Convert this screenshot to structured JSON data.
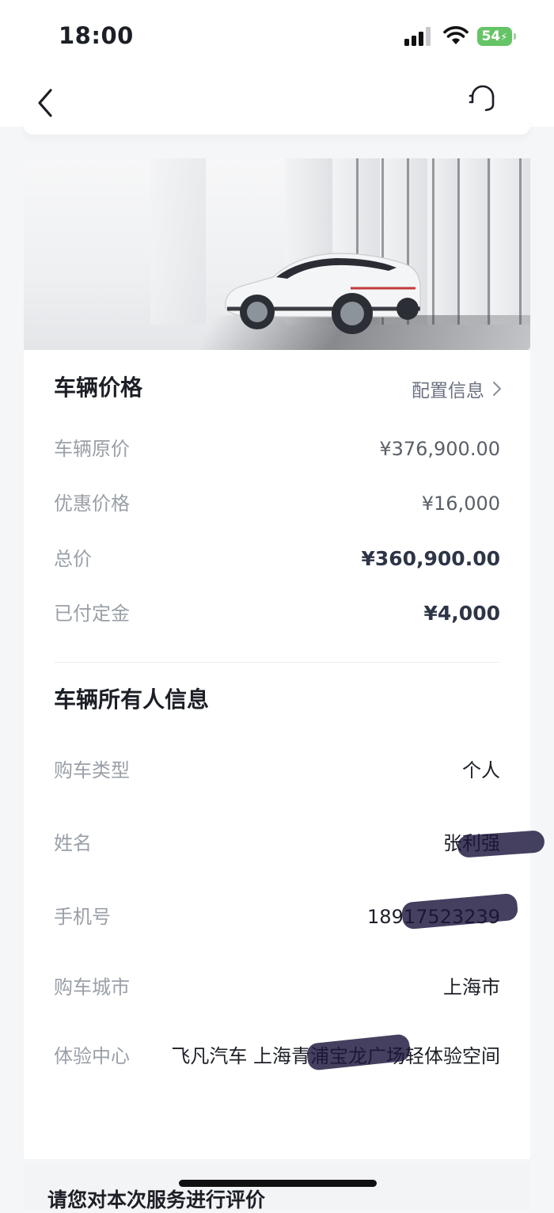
{
  "status_bar": {
    "time": "18:00",
    "battery": "54"
  },
  "nav": {
    "back_icon": "chevron-left-icon",
    "service_icon": "headset-icon"
  },
  "price_section": {
    "title": "车辆价格",
    "config_link": "配置信息",
    "rows": [
      {
        "label": "车辆原价",
        "value": "¥376,900.00"
      },
      {
        "label": "优惠价格",
        "value": "¥16,000"
      },
      {
        "label": "总价",
        "value": "¥360,900.00"
      },
      {
        "label": "已付定金",
        "value": "¥4,000"
      }
    ]
  },
  "owner_section": {
    "title": "车辆所有人信息",
    "rows": [
      {
        "label": "购车类型",
        "value": "个人"
      },
      {
        "label": "姓名",
        "value": "张利强"
      },
      {
        "label": "手机号",
        "value": "18917523239"
      },
      {
        "label": "购车城市",
        "value": "上海市"
      },
      {
        "label": "体验中心",
        "value": "飞凡汽车  上海青浦宝龙广场轻体验空间"
      }
    ]
  },
  "rating": {
    "prompt": "请您对本次服务进行评价"
  },
  "colors": {
    "background": "#f5f6f8",
    "card": "#ffffff",
    "label": "#9aa0a8",
    "emphasis": "#2d3547",
    "battery": "#65c466"
  }
}
